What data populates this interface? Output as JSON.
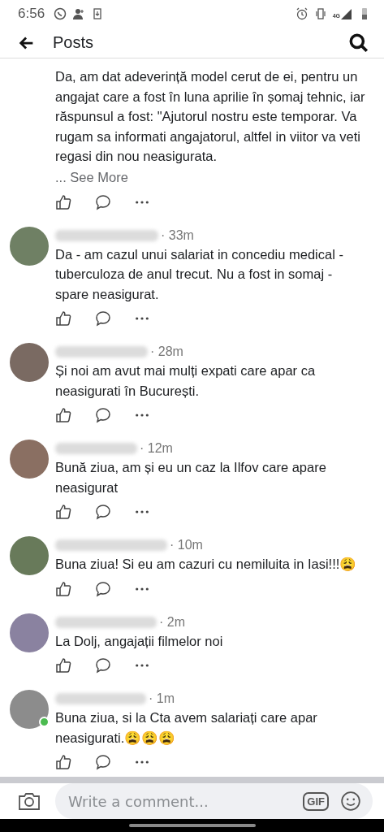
{
  "status_bar": {
    "time": "6:56",
    "network": "4G"
  },
  "header": {
    "title": "Posts"
  },
  "comments": [
    {
      "text": "Da, am dat adeverință model cerut de ei, pentru un angajat care a fost în luna aprilie în șomaj tehnic, iar răspunsul a fost: \"Ajutorul nostru este temporar. Va rugam sa informati angajatorul, altfel in viitor va veti regasi din nou neasigurata.",
      "see_more": "... See More",
      "online": false
    },
    {
      "time": "· 33m",
      "text": "Da - am cazul unui salariat in concediu medical - tuberculoza de anul trecut. Nu a fost in somaj - spare neasigurat.",
      "color": "#6f8064",
      "online": false
    },
    {
      "time": "· 28m",
      "text": "Și noi am avut mai mulți expati care apar ca neasigurati în București.",
      "color": "#7a6a62",
      "online": false
    },
    {
      "time": "· 12m",
      "text": "Bună ziua, am și eu un caz la Ilfov care apare neasigurat",
      "color": "#8a6f62",
      "online": false
    },
    {
      "time": "· 10m",
      "text": "Buna ziua! Si eu am cazuri cu nemiluita in Iasi!!!😩",
      "color": "#687a5a",
      "online": false
    },
    {
      "time": "· 2m",
      "text": "La Dolj,  angajații filmelor noi",
      "color": "#8a82a0",
      "online": false
    },
    {
      "time": "· 1m",
      "text": "Buna ziua, si la Cta avem salariați care apar neasigurati.😩😩😩",
      "color": "#8c8c8c",
      "online": true
    }
  ],
  "composer": {
    "placeholder": "Write a comment...",
    "gif": "GIF"
  }
}
